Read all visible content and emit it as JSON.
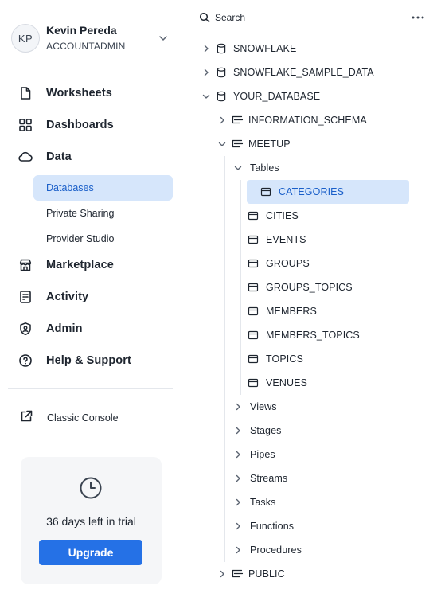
{
  "user": {
    "initials": "KP",
    "name": "Kevin Pereda",
    "role": "ACCOUNTADMIN"
  },
  "nav": {
    "worksheets": "Worksheets",
    "dashboards": "Dashboards",
    "data": "Data",
    "databases": "Databases",
    "private_sharing": "Private Sharing",
    "provider_studio": "Provider Studio",
    "marketplace": "Marketplace",
    "activity": "Activity",
    "admin": "Admin",
    "help": "Help & Support",
    "classic_console": "Classic Console"
  },
  "trial": {
    "text": "36 days left in trial",
    "button": "Upgrade"
  },
  "tree": {
    "search_label": "Search",
    "databases": [
      "SNOWFLAKE",
      "SNOWFLAKE_SAMPLE_DATA",
      "YOUR_DATABASE"
    ],
    "schemas": [
      "INFORMATION_SCHEMA",
      "MEETUP",
      "PUBLIC"
    ],
    "tables_label": "Tables",
    "tables": [
      "CATEGORIES",
      "CITIES",
      "EVENTS",
      "GROUPS",
      "GROUPS_TOPICS",
      "MEMBERS",
      "MEMBERS_TOPICS",
      "TOPICS",
      "VENUES"
    ],
    "object_groups": [
      "Views",
      "Stages",
      "Pipes",
      "Streams",
      "Tasks",
      "Functions",
      "Procedures"
    ]
  },
  "colors": {
    "accent": "#2571e6",
    "selection_bg": "#d6e6fb",
    "selection_text": "#1a5fc9"
  }
}
